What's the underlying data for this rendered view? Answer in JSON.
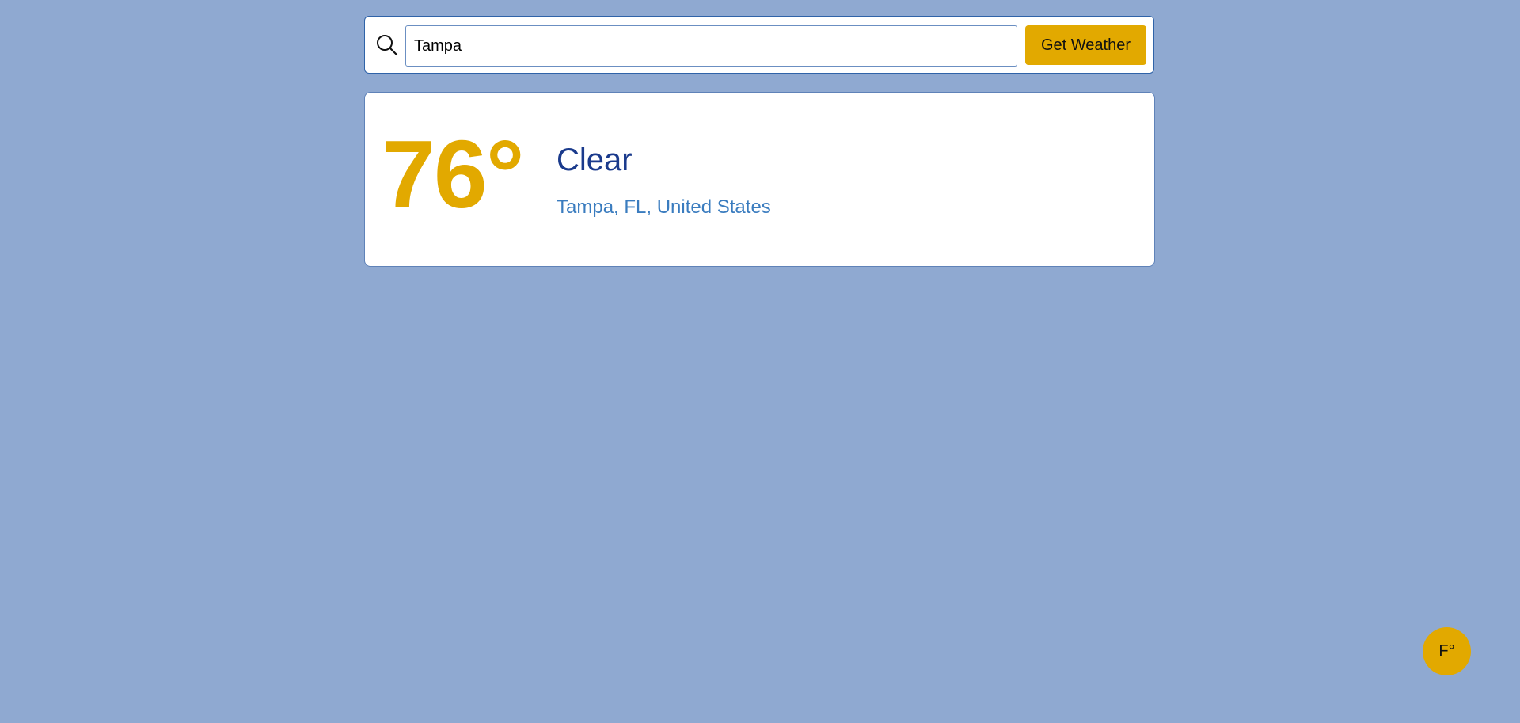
{
  "search": {
    "value": "Tampa",
    "button_label": "Get Weather",
    "icon": "search-icon"
  },
  "weather": {
    "temperature": "76°",
    "condition": "Clear",
    "location": "Tampa, FL, United States"
  },
  "unit_toggle": {
    "label": "F°"
  },
  "colors": {
    "background": "#8fa9d1",
    "accent": "#e2a900",
    "condition_text": "#1a3a8c",
    "location_text": "#3a7cbf",
    "border": "#2f63a8"
  }
}
